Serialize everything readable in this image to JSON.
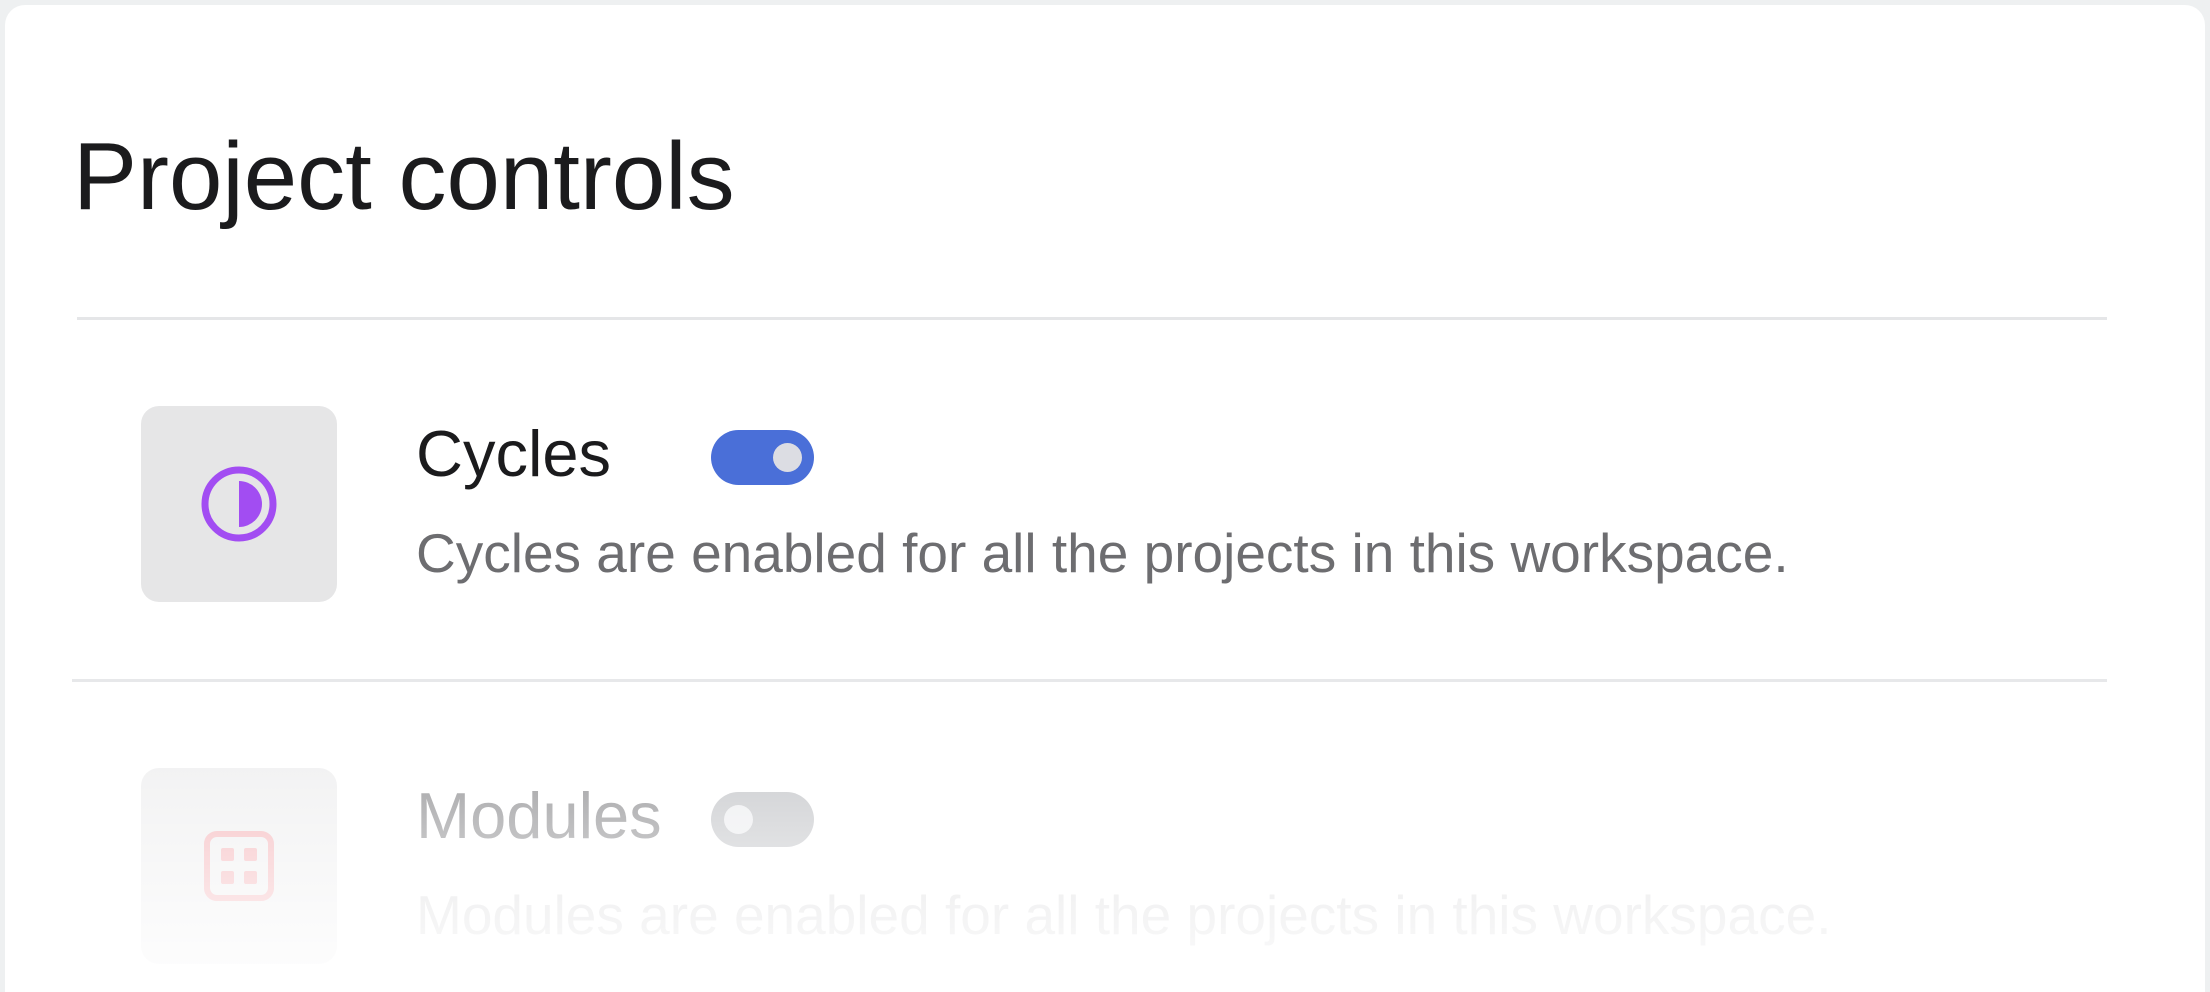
{
  "page": {
    "title": "Project controls"
  },
  "features": [
    {
      "name": "Cycles",
      "description": "Cycles are enabled for all the projects in this workspace.",
      "enabled": true,
      "icon": "cycles-icon",
      "icon_color": "#a24df2",
      "toggle_color": "#4a6fd8"
    },
    {
      "name": "Modules",
      "description": "Modules are enabled for all the projects in this workspace.",
      "enabled": false,
      "icon": "modules-icon",
      "icon_color": "#f2a6ab",
      "toggle_color": "#b9bbbf"
    }
  ]
}
